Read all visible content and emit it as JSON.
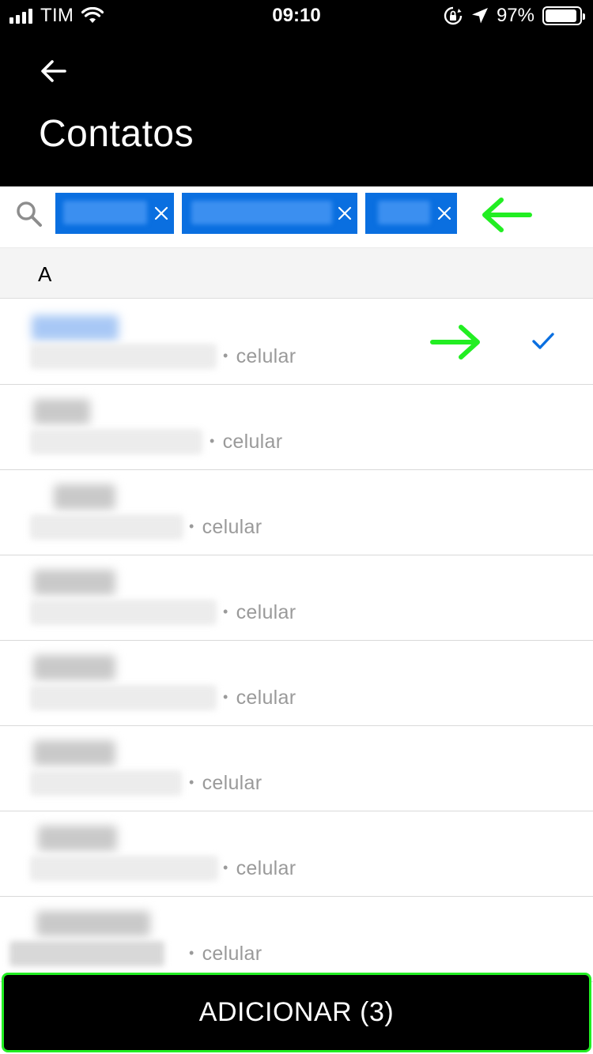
{
  "status_bar": {
    "carrier": "TIM",
    "time": "09:10",
    "battery": "97%"
  },
  "header": {
    "title": "Contatos",
    "back_icon": "arrow-left-icon"
  },
  "chips": {
    "search_icon": "search-icon",
    "count": 3,
    "close_icon": "close-icon",
    "chip_color": "#0a6fe0"
  },
  "annotation_color": "#22ee22",
  "section": {
    "letter": "A"
  },
  "contacts": [
    {
      "type": "celular",
      "selected": true
    },
    {
      "type": "celular",
      "selected": false
    },
    {
      "type": "celular",
      "selected": false
    },
    {
      "type": "celular",
      "selected": false
    },
    {
      "type": "celular",
      "selected": false
    },
    {
      "type": "celular",
      "selected": false
    },
    {
      "type": "celular",
      "selected": false
    },
    {
      "type": "celular",
      "selected": false
    }
  ],
  "check_color": "#0a6fe0",
  "footer": {
    "add_label": "ADICIONAR (3)"
  }
}
